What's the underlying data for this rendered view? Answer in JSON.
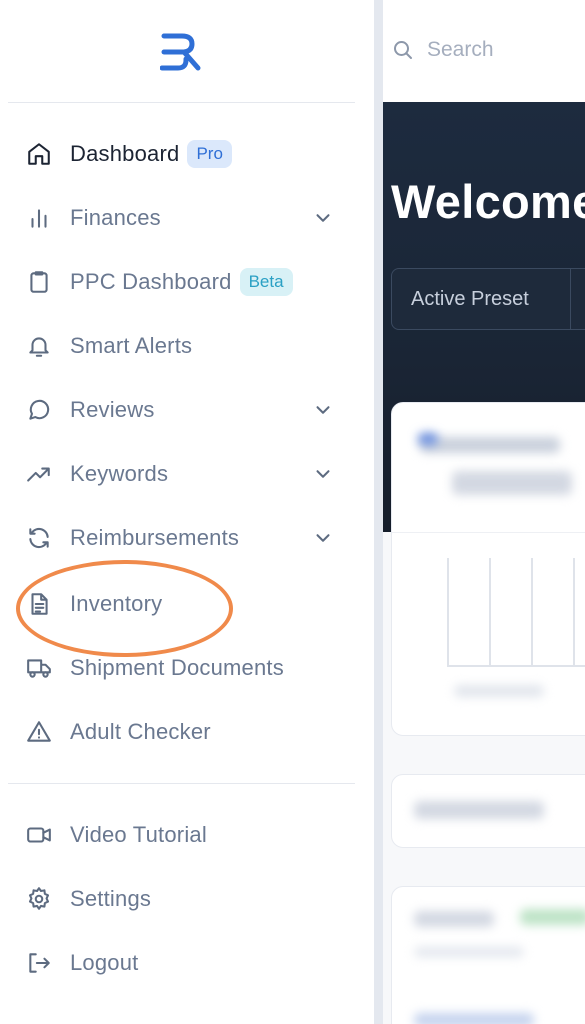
{
  "brand": {
    "logo_text": "SR",
    "logo_color": "#2f6fd6"
  },
  "sidebar": {
    "items": [
      {
        "label": "Dashboard",
        "badge": "Pro",
        "icon": "home-icon",
        "active": true
      },
      {
        "label": "Finances",
        "icon": "bar-chart-icon",
        "expandable": true
      },
      {
        "label": "PPC Dashboard",
        "badge": "Beta",
        "icon": "clipboard-icon"
      },
      {
        "label": "Smart Alerts",
        "icon": "bell-icon"
      },
      {
        "label": "Reviews",
        "icon": "message-circle-icon",
        "expandable": true
      },
      {
        "label": "Keywords",
        "icon": "trending-up-icon",
        "expandable": true
      },
      {
        "label": "Reimbursements",
        "icon": "refresh-icon",
        "expandable": true
      },
      {
        "label": "Inventory",
        "icon": "file-text-icon",
        "highlighted": true
      },
      {
        "label": "Shipment Documents",
        "icon": "truck-icon"
      },
      {
        "label": "Adult Checker",
        "icon": "alert-triangle-icon"
      }
    ],
    "footer_items": [
      {
        "label": "Video Tutorial",
        "icon": "video-icon"
      },
      {
        "label": "Settings",
        "icon": "gear-icon"
      },
      {
        "label": "Logout",
        "icon": "logout-icon"
      }
    ],
    "highlight_color": "#f08a4b"
  },
  "search": {
    "placeholder": "Search",
    "value": ""
  },
  "main": {
    "welcome_text": "Welcome",
    "preset_button_label": "Active Preset"
  },
  "colors": {
    "accent": "#2f6fd6",
    "hero_bg": "#1d2b3f",
    "pro_badge_bg": "#dbe8fb",
    "beta_badge_bg": "#d8f1f6"
  }
}
